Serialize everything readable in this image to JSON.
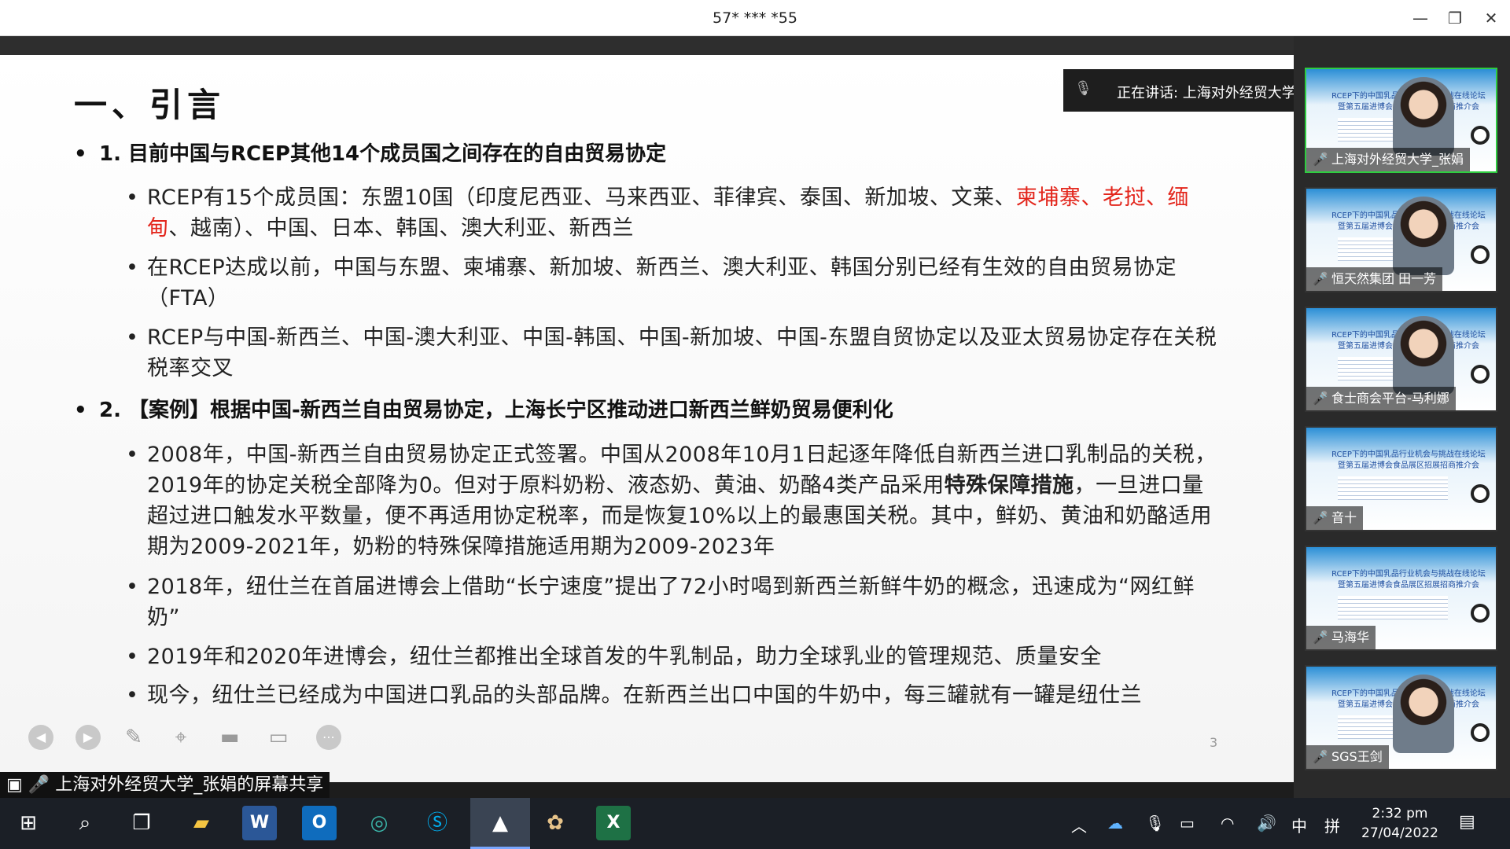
{
  "window": {
    "title": "57* *** *55",
    "minimize": "—",
    "restore": "❐",
    "close": "✕"
  },
  "slide": {
    "heading": "一、引言",
    "page_number": "3",
    "section1": {
      "title": "1. 目前中国与RCEP其他14个成员国之间存在的自由贸易协定"
    },
    "b1": {
      "pre": "RCEP有15个成员国：东盟10国（印度尼西亚、马来西亚、菲律宾、泰国、新加坡、文莱、",
      "red": "柬埔寨、老挝、缅甸",
      "post": "、越南）、中国、日本、韩国、澳大利亚、新西兰"
    },
    "b2": "在RCEP达成以前，中国与东盟、柬埔寨、新加坡、新西兰、澳大利亚、韩国分别已经有生效的自由贸易协定（FTA）",
    "b3": "RCEP与中国-新西兰、中国-澳大利亚、中国-韩国、中国-新加坡、中国-东盟自贸协定以及亚太贸易协定存在关税税率交叉",
    "section2": {
      "title": "2. 【案例】根据中国-新西兰自由贸易协定，上海长宁区推动进口新西兰鲜奶贸易便利化"
    },
    "b4": {
      "pre": "2008年，中国-新西兰自由贸易协定正式签署。中国从2008年10月1日起逐年降低自新西兰进口乳制品的关税，2019年的协定关税全部降为0。但对于原料奶粉、液态奶、黄油、奶酪4类产品采用",
      "bold": "特殊保障措施",
      "post": "，一旦进口量超过进口触发水平数量，便不再适用协定税率，而是恢复10%以上的最惠国关税。其中，鲜奶、黄油和奶酪适用期为2009-2021年，奶粉的特殊保障措施适用期为2009-2023年"
    },
    "b5": "2018年，纽仕兰在首届进博会上借助“长宁速度”提出了72小时喝到新西兰新鲜牛奶的概念，迅速成为“网红鲜奶”",
    "b6": "2019年和2020年进博会，纽仕兰都推出全球首发的牛乳制品，助力全球乳业的管理规范、质量安全",
    "b7": "现今，纽仕兰已经成为中国进口乳品的头部品牌。在新西兰出口中国的牛奶中，每三罐就有一罐是纽仕兰"
  },
  "speaking": {
    "text": "正在讲话: 上海对外经贸大学_..."
  },
  "participants": [
    {
      "name": "上海对外经贸大学_张娟",
      "mic": "on",
      "active": true
    },
    {
      "name": "恒天然集团 田一芳",
      "mic": "off",
      "active": false
    },
    {
      "name": "食士商会平台-马利娜",
      "mic": "off",
      "active": false
    },
    {
      "name": "音十",
      "mic": "off",
      "active": false
    },
    {
      "name": "马海华",
      "mic": "on",
      "active": false
    },
    {
      "name": "SGS王剑",
      "mic": "off",
      "active": false
    }
  ],
  "tile_slide_title": "RCEP下的中国乳品行业机会与挑战在线论坛 暨第五届进博会食品展区招展招商推介会",
  "share_label": "上海对外经贸大学_张娟的屏幕共享",
  "taskbar": {
    "apps": [
      "start-icon",
      "search-icon",
      "task-view-icon",
      "file-explorer-icon",
      "word-icon",
      "outlook-icon",
      "edge-icon",
      "skype-icon",
      "meeting-icon",
      "paint-icon",
      "excel-icon"
    ],
    "ime1": "中",
    "ime2": "拼",
    "time": "2:32 pm",
    "date": "27/04/2022"
  }
}
